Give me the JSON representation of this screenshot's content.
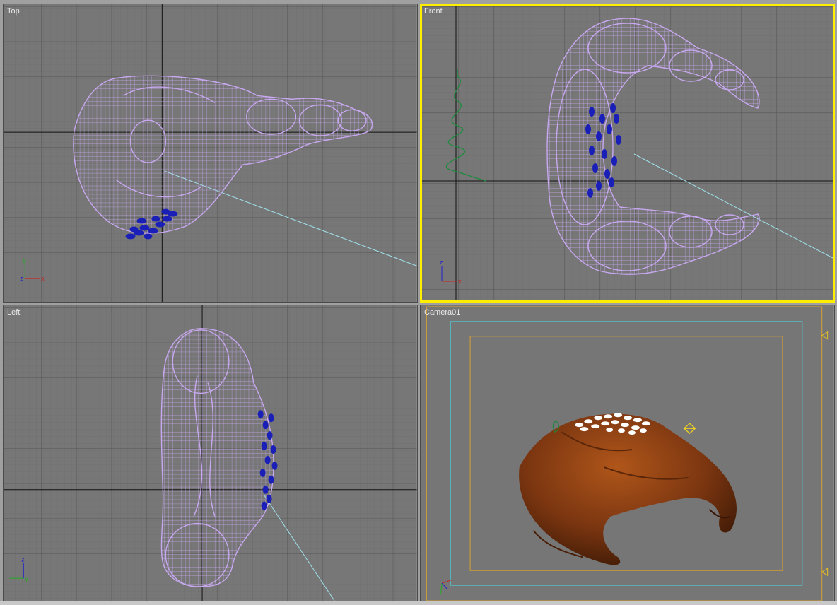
{
  "viewports": {
    "top": {
      "label": "Top"
    },
    "front": {
      "label": "Front"
    },
    "left": {
      "label": "Left"
    },
    "camera": {
      "label": "Camera01"
    }
  },
  "axis_labels": {
    "x": "x",
    "y": "y",
    "z": "z"
  },
  "colors": {
    "viewport_bg": "#777777",
    "grid_minor": "#6b6b6b",
    "grid_major": "#555555",
    "axis_line": "#111111",
    "wireframe": "#c8a8f0",
    "seeds": "#1a1fb8",
    "active_border": "#ffee00",
    "safe_frame_cyan": "#4ad0d8",
    "safe_frame_gold": "#d8a030",
    "croissant": "#8a3e10"
  }
}
